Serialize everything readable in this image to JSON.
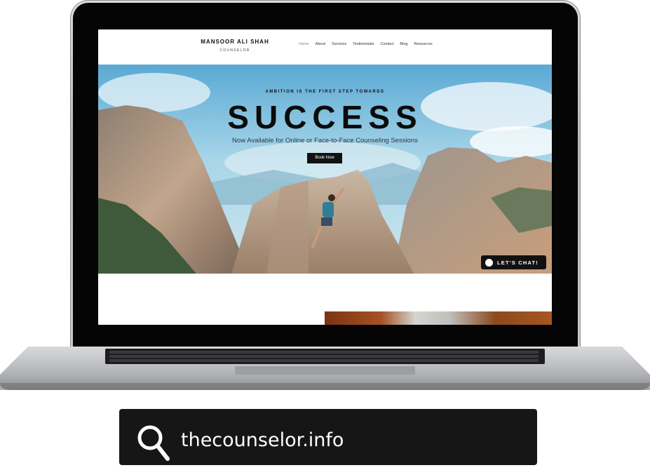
{
  "site": {
    "brand_name": "MANSOOR ALI SHAH",
    "brand_subtitle": "COUNSELOR",
    "nav": [
      "Home",
      "About",
      "Services",
      "Testimonials",
      "Contact",
      "Blog",
      "Resources"
    ],
    "active_nav": "Home"
  },
  "hero": {
    "kicker": "AMBITION IS THE FIRST STEP TOWARDS",
    "title": "SUCCESS",
    "subtitle": "Now Available for Online or Face-to-Face Counseling Sessions",
    "cta_label": "Book Now"
  },
  "chat": {
    "label": "LET'S CHAT!"
  },
  "caption": {
    "icon": "search-icon",
    "text": "thecounselor.info"
  },
  "colors": {
    "sky": "#6fb3d6",
    "rock": "#b9a08a",
    "dark": "#111111"
  }
}
